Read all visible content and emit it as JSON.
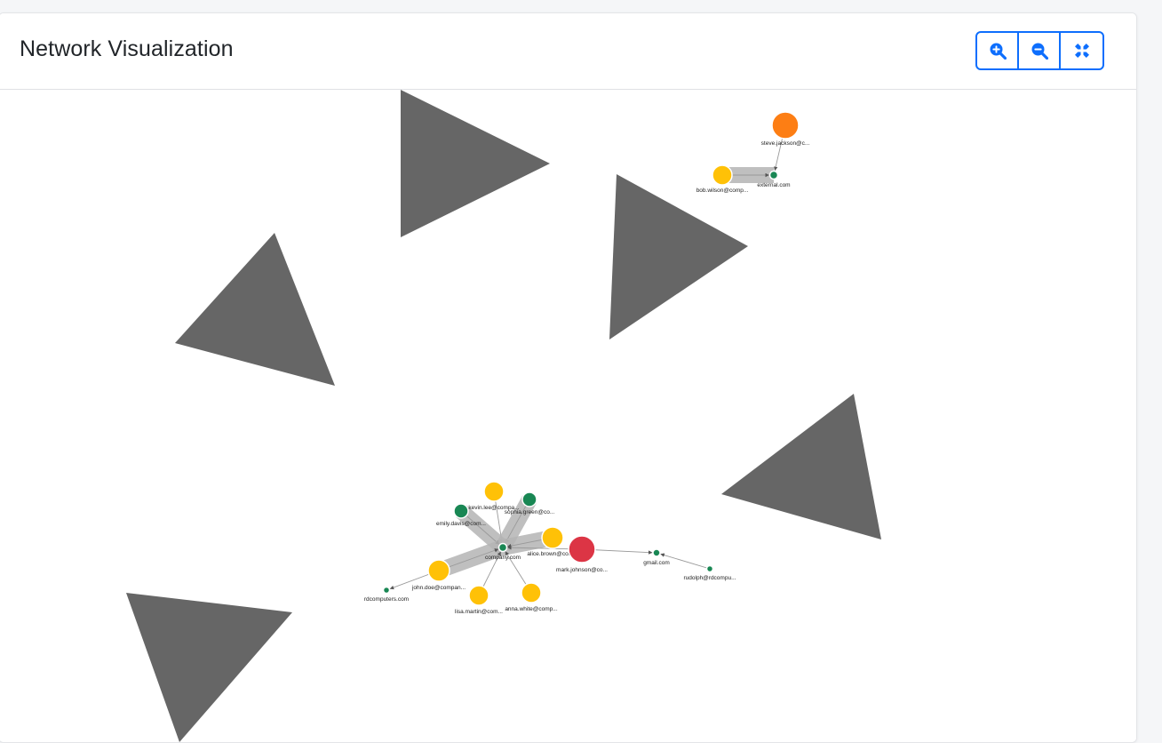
{
  "header": {
    "title": "Network Visualization"
  },
  "toolbar": {
    "zoom_in_icon": "zoom-in-icon",
    "zoom_out_icon": "zoom-out-icon",
    "fit_icon": "compress-icon",
    "accent_color": "#0d6efd"
  },
  "graph": {
    "colors": {
      "domain": "#198754",
      "user": "#ffc107",
      "external_user": "#fd7e14",
      "alert_user": "#dc3545",
      "edge": "#b4b4b4",
      "overlay": "#666666"
    },
    "nodes": [
      {
        "id": "steve",
        "label": "steve.jackson@c...",
        "type": "external_user"
      },
      {
        "id": "bob",
        "label": "bob.wilson@comp...",
        "type": "user"
      },
      {
        "id": "external",
        "label": "external.com",
        "type": "domain"
      },
      {
        "id": "kevin",
        "label": "kevin.lee@compa...",
        "type": "user"
      },
      {
        "id": "sophia",
        "label": "sophia.green@co...",
        "type": "domain"
      },
      {
        "id": "emily",
        "label": "emily.davis@com...",
        "type": "domain"
      },
      {
        "id": "alice",
        "label": "alice.brown@com...",
        "type": "user"
      },
      {
        "id": "company",
        "label": "company.com",
        "type": "domain"
      },
      {
        "id": "mark",
        "label": "mark.johnson@co...",
        "type": "alert_user"
      },
      {
        "id": "gmail",
        "label": "gmail.com",
        "type": "domain"
      },
      {
        "id": "rudolph",
        "label": "rudolph@rdcompu...",
        "type": "domain"
      },
      {
        "id": "john",
        "label": "john.doe@compan...",
        "type": "user"
      },
      {
        "id": "rdcomputers",
        "label": "rdcomputers.com",
        "type": "domain"
      },
      {
        "id": "lisa",
        "label": "lisa.martin@com...",
        "type": "user"
      },
      {
        "id": "anna",
        "label": "anna.white@comp...",
        "type": "user"
      }
    ],
    "edges": [
      {
        "from": "steve",
        "to": "external",
        "weight": "thin"
      },
      {
        "from": "bob",
        "to": "external",
        "weight": "thick"
      },
      {
        "from": "kevin",
        "to": "company",
        "weight": "thin"
      },
      {
        "from": "sophia",
        "to": "company",
        "weight": "thick"
      },
      {
        "from": "emily",
        "to": "company",
        "weight": "thick"
      },
      {
        "from": "alice",
        "to": "company",
        "weight": "thick"
      },
      {
        "from": "john",
        "to": "company",
        "weight": "thick"
      },
      {
        "from": "lisa",
        "to": "company",
        "weight": "thin"
      },
      {
        "from": "anna",
        "to": "company",
        "weight": "thin"
      },
      {
        "from": "mark",
        "to": "company",
        "weight": "thin"
      },
      {
        "from": "mark",
        "to": "gmail",
        "weight": "thin"
      },
      {
        "from": "rudolph",
        "to": "gmail",
        "weight": "thin"
      },
      {
        "from": "john",
        "to": "rdcomputers",
        "weight": "thin"
      }
    ]
  }
}
